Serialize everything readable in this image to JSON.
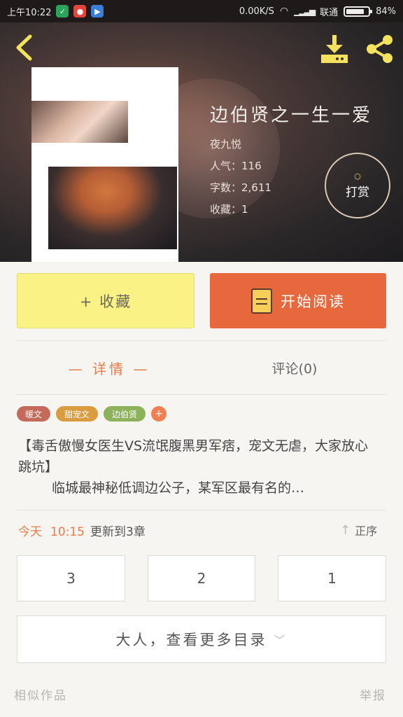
{
  "status_bar": {
    "time": "上午10:22",
    "network_speed": "0.00K/S",
    "carrier": "联通",
    "battery": "84%",
    "battery_level": 0.84
  },
  "book": {
    "title": "边伯贤之一生一爱",
    "author": "夜九悦",
    "popularity": "人气：116",
    "word_count": "字数：2,611",
    "favorites": "收藏：1"
  },
  "tip_button": {
    "label": "打赏"
  },
  "actions": {
    "favorite_label": "+ 收藏",
    "read_label": "开始阅读"
  },
  "tabs": {
    "detail": "— 详情 —",
    "comments": "评论(0)"
  },
  "tags": [
    {
      "label": "暖文",
      "color": "#c46a5a"
    },
    {
      "label": "甜宠文",
      "color": "#d99c3f"
    },
    {
      "label": "边伯贤",
      "color": "#8db35a"
    }
  ],
  "tag_add": "+",
  "synopsis": {
    "line1": "【毒舌傲慢女医生VS流氓腹黑男军痞，宠文无虐，大家放心跳坑】",
    "line2": "临城最神秘低调边公子，某军区最有名的…"
  },
  "update": {
    "today": "今天",
    "time": "10:15",
    "text": "更新到3章"
  },
  "sort": {
    "label": "正序"
  },
  "chapters": [
    "3",
    "2",
    "1"
  ],
  "more_catalog": "大人，查看更多目录",
  "footer": {
    "similar": "相似作品",
    "report": "举报"
  }
}
